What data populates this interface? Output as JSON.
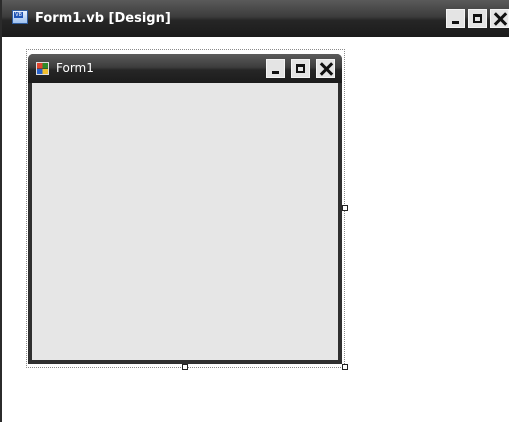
{
  "designer_window": {
    "title": "Form1.vb [Design]",
    "icon": "vb-file-icon",
    "controls": [
      "minimize",
      "maximize",
      "close"
    ]
  },
  "form": {
    "title": "Form1",
    "icon": "form-icon",
    "controls": [
      "minimize",
      "maximize",
      "close"
    ],
    "client_color": "#e6e6e6"
  },
  "colors": {
    "titlebar": "#262626",
    "canvas": "#ffffff"
  }
}
